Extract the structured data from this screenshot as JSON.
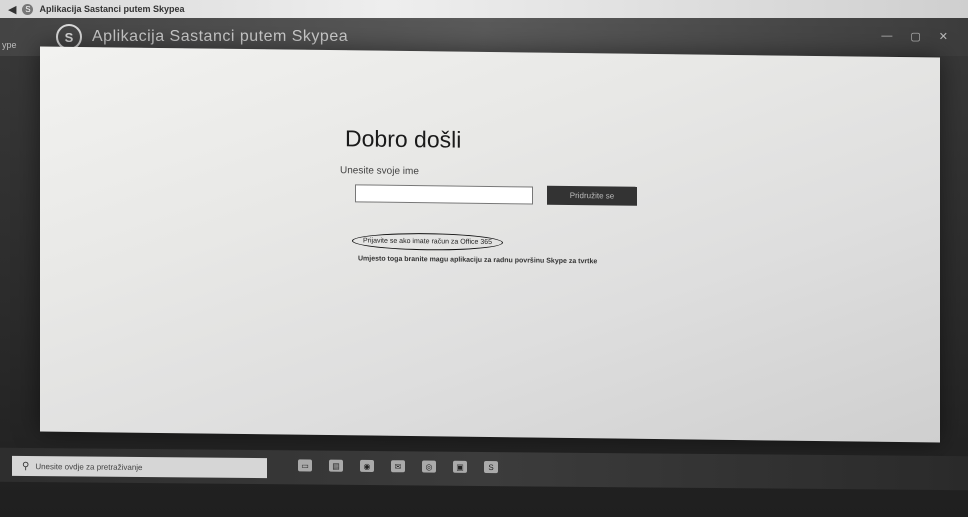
{
  "browser": {
    "tab_title": "Aplikacija Sastanci putem Skypea"
  },
  "app": {
    "side_label": "ype",
    "title": "Aplikacija Sastanci putem Skypea",
    "logo_letter": "S"
  },
  "main": {
    "welcome": "Dobro došli",
    "name_label": "Unesite svoje ime",
    "name_value": "",
    "join_button": "Pridružite se",
    "signin_link": "Prijavite se ako imate račun za Office 365",
    "download_link": "Umjesto toga branite magu aplikaciju za radnu površinu Skype za tvrtke"
  },
  "taskbar": {
    "search_placeholder": "Unesite ovdje za pretraživanje"
  },
  "icons": {
    "back": "back-arrow-icon",
    "search": "search-icon"
  }
}
